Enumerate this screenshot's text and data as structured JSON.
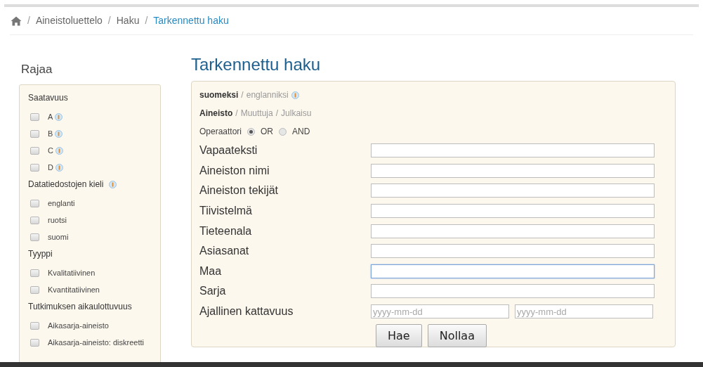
{
  "breadcrumb": [
    {
      "separator": "/",
      "label": "Aineistoluettelo",
      "current": false
    },
    {
      "separator": "/",
      "label": "Haku",
      "current": false
    },
    {
      "separator": "/",
      "label": "Tarkennettu haku",
      "current": true
    }
  ],
  "sidebar": {
    "title": "Rajaa",
    "groups": [
      {
        "title": "Saatavuus",
        "info": false,
        "items": [
          {
            "label": "A",
            "checked": false,
            "info": true
          },
          {
            "label": "B",
            "checked": false,
            "info": true
          },
          {
            "label": "C",
            "checked": false,
            "info": true
          },
          {
            "label": "D",
            "checked": false,
            "info": true
          }
        ]
      },
      {
        "title": "Datatiedostojen kieli",
        "info": true,
        "items": [
          {
            "label": "englanti",
            "checked": false,
            "info": false
          },
          {
            "label": "ruotsi",
            "checked": false,
            "info": false
          },
          {
            "label": "suomi",
            "checked": false,
            "info": false
          }
        ]
      },
      {
        "title": "Tyyppi",
        "info": false,
        "items": [
          {
            "label": "Kvalitatiivinen",
            "checked": false,
            "info": false
          },
          {
            "label": "Kvantitatiivinen",
            "checked": false,
            "info": false
          }
        ]
      },
      {
        "title": "Tutkimuksen aikaulottuvuus",
        "info": false,
        "items": [
          {
            "label": "Aikasarja-aineisto",
            "checked": false,
            "info": false
          },
          {
            "label": "Aikasarja-aineisto: diskreetti",
            "checked": false,
            "info": false
          }
        ]
      }
    ]
  },
  "main": {
    "title": "Tarkennettu haku",
    "languages": [
      {
        "label": "suomeksi",
        "selected": true
      },
      {
        "separator": "/",
        "label": "englanniksi",
        "selected": false
      }
    ],
    "targets": [
      {
        "label": "Aineisto",
        "selected": true
      },
      {
        "separator": "/",
        "label": "Muuttuja",
        "selected": false
      },
      {
        "separator": "/",
        "label": "Julkaisu",
        "selected": false
      }
    ],
    "operator": {
      "label": "Operaattori",
      "options": [
        {
          "label": "OR",
          "selected": true
        },
        {
          "label": "AND",
          "selected": false
        }
      ]
    },
    "fields": [
      {
        "label": "Vapaateksti",
        "kind": "text",
        "focused": false
      },
      {
        "label": "Aineiston nimi",
        "kind": "text",
        "focused": false
      },
      {
        "label": "Aineiston tekijät",
        "kind": "text",
        "focused": false
      },
      {
        "label": "Tiivistelmä",
        "kind": "text",
        "focused": false
      },
      {
        "label": "Tieteenala",
        "kind": "text",
        "focused": false
      },
      {
        "label": "Asiasanat",
        "kind": "text",
        "focused": false
      },
      {
        "label": "Maa",
        "kind": "text",
        "focused": true
      },
      {
        "label": "Sarja",
        "kind": "text",
        "focused": false
      },
      {
        "label": "Ajallinen kattavuus",
        "kind": "date-range",
        "focused": false,
        "placeholders": [
          "yyyy-mm-dd",
          "yyyy-mm-dd"
        ]
      }
    ],
    "buttons": [
      "Hae",
      "Nollaa"
    ]
  }
}
